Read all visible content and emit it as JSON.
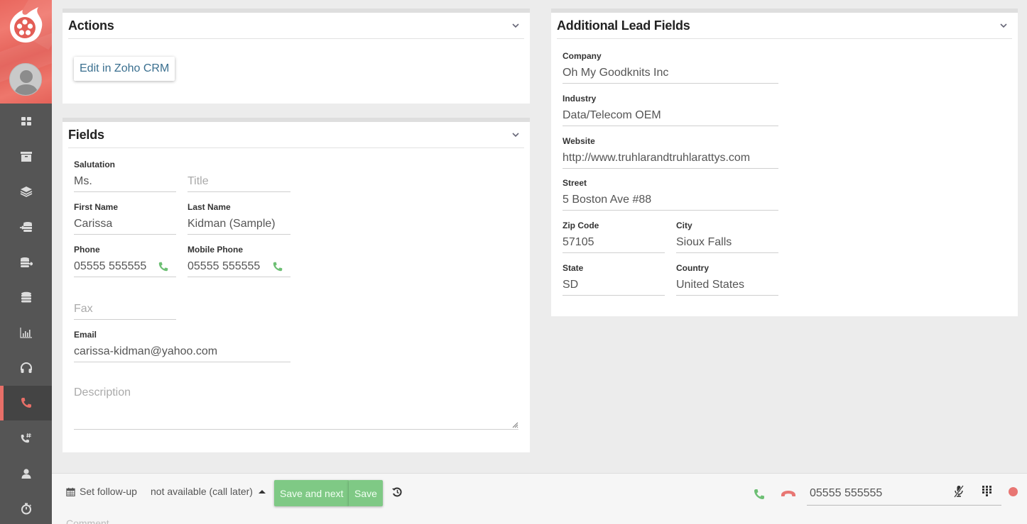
{
  "sidebar": {
    "logo": "film-reel-flame-logo",
    "avatar": "user-avatar",
    "items": [
      {
        "id": "dashboard",
        "icon": "grid-icon",
        "active": false
      },
      {
        "id": "archive",
        "icon": "archive-box-icon",
        "active": false
      },
      {
        "id": "layers",
        "icon": "layers-icon",
        "active": false
      },
      {
        "id": "import",
        "icon": "database-import-icon",
        "active": false
      },
      {
        "id": "export",
        "icon": "database-export-icon",
        "active": false
      },
      {
        "id": "database",
        "icon": "database-icon",
        "active": false
      },
      {
        "id": "reports",
        "icon": "bar-chart-icon",
        "active": false
      },
      {
        "id": "support",
        "icon": "headphones-icon",
        "active": false
      },
      {
        "id": "calls",
        "icon": "phone-icon",
        "active": true
      },
      {
        "id": "call-numbers",
        "icon": "phone-hash-icon",
        "active": false
      },
      {
        "id": "users",
        "icon": "user-icon",
        "active": false
      },
      {
        "id": "timer",
        "icon": "stopwatch-icon",
        "active": false
      }
    ],
    "accent_color": "#e86f68"
  },
  "actions": {
    "title": "Actions",
    "edit_button": "Edit in Zoho CRM"
  },
  "fields": {
    "title": "Fields",
    "salutation": {
      "label": "Salutation",
      "value": "Ms."
    },
    "title_field": {
      "placeholder": "Title"
    },
    "first_name": {
      "label": "First Name",
      "value": "Carissa"
    },
    "last_name": {
      "label": "Last Name",
      "value": "Kidman (Sample)"
    },
    "phone": {
      "label": "Phone",
      "value": "05555 555555"
    },
    "mobile_phone": {
      "label": "Mobile Phone",
      "value": "05555 555555"
    },
    "fax": {
      "placeholder": "Fax"
    },
    "email": {
      "label": "Email",
      "value": "carissa-kidman@yahoo.com"
    },
    "description": {
      "placeholder": "Description"
    }
  },
  "additional": {
    "title": "Additional Lead Fields",
    "company": {
      "label": "Company",
      "value": "Oh My Goodknits Inc"
    },
    "industry": {
      "label": "Industry",
      "value": "Data/Telecom OEM"
    },
    "website": {
      "label": "Website",
      "value": "http://www.truhlarandtruhlarattys.com"
    },
    "street": {
      "label": "Street",
      "value": "5 Boston Ave #88"
    },
    "zip": {
      "label": "Zip Code",
      "value": "57105"
    },
    "city": {
      "label": "City",
      "value": "Sioux Falls"
    },
    "state": {
      "label": "State",
      "value": "SD"
    },
    "country": {
      "label": "Country",
      "value": "United States"
    }
  },
  "bottombar": {
    "followup_label": "Set follow-up",
    "status_value": "not available (call later)",
    "save_next_label": "Save and next",
    "save_label": "Save",
    "comment_placeholder": "Comment",
    "dial_number": "05555 555555",
    "colors": {
      "green": "#7fc985",
      "red": "#e87673"
    }
  }
}
